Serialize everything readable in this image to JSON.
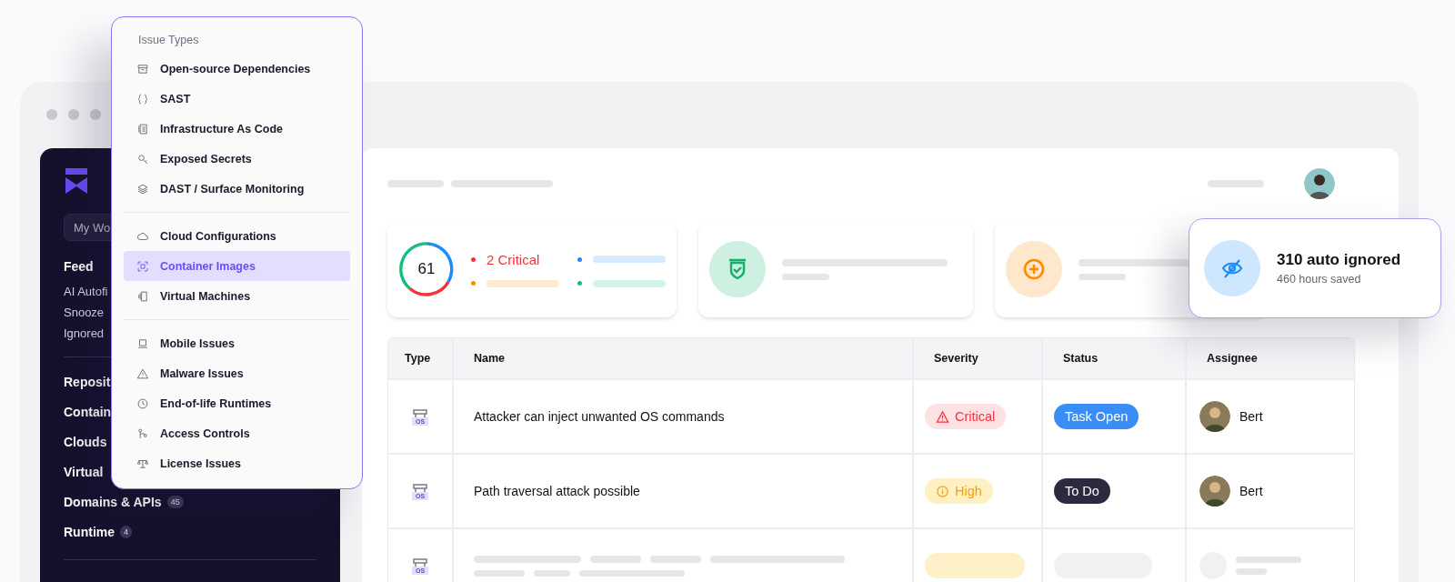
{
  "sidebar": {
    "search": {
      "placeholder": "My Wo"
    },
    "feed": {
      "heading": "Feed",
      "items": [
        "AI Autofi",
        "Snooze",
        "Ignored"
      ]
    },
    "nav": [
      {
        "label": "Reposit"
      },
      {
        "label": "Contain"
      },
      {
        "label": "Clouds"
      },
      {
        "label": "Virtual"
      },
      {
        "label": "Domains & APIs",
        "badge": "45"
      },
      {
        "label": "Runtime",
        "badge": "4"
      }
    ]
  },
  "issue_types_menu": {
    "title": "Issue Types",
    "groups": [
      [
        {
          "label": "Open-source Dependencies",
          "selected": false
        },
        {
          "label": "SAST",
          "selected": false
        },
        {
          "label": "Infrastructure As Code",
          "selected": false
        },
        {
          "label": "Exposed Secrets",
          "selected": false
        },
        {
          "label": "DAST / Surface Monitoring",
          "selected": false
        }
      ],
      [
        {
          "label": "Cloud Configurations",
          "selected": false
        },
        {
          "label": "Container Images",
          "selected": true
        },
        {
          "label": "Virtual Machines",
          "selected": false
        }
      ],
      [
        {
          "label": "Mobile Issues",
          "selected": false
        },
        {
          "label": "Malware Issues",
          "selected": false
        },
        {
          "label": "End-of-life Runtimes",
          "selected": false
        },
        {
          "label": "Access Controls",
          "selected": false
        },
        {
          "label": "License Issues",
          "selected": false
        }
      ]
    ]
  },
  "summary": {
    "score": "61",
    "legend": [
      {
        "label": "2 Critical",
        "color": "#f5333f"
      },
      {
        "color": "#1a8cff"
      },
      {
        "color": "#ff8a00"
      },
      {
        "color": "#12c07a"
      }
    ]
  },
  "auto_ignored_card": {
    "title": "310 auto ignored",
    "subtitle": "460 hours saved"
  },
  "table": {
    "columns": [
      "Type",
      "Name",
      "Severity",
      "Status",
      "Assignee"
    ],
    "rows": [
      {
        "kind": "issue",
        "type": "OS",
        "name": "Attacker can inject unwanted OS commands",
        "severity": {
          "kind": "critical",
          "label": "Critical"
        },
        "status": {
          "kind": "open",
          "label": "Task Open"
        },
        "assignee": "Bert"
      },
      {
        "kind": "issue",
        "type": "OS",
        "name": "Path traversal attack possible",
        "severity": {
          "kind": "high",
          "label": "High"
        },
        "status": {
          "kind": "todo",
          "label": "To Do"
        },
        "assignee": "Bert"
      },
      {
        "kind": "placeholder",
        "type": "OS"
      }
    ]
  }
}
